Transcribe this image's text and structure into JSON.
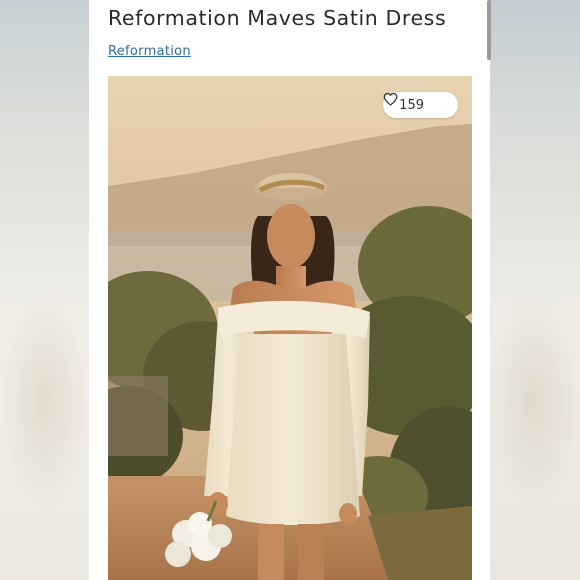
{
  "listing": {
    "title": "Reformation Maves Satin Dress",
    "brand_link": "Reformation",
    "like_count": "159",
    "like_icon": "heart-outline-icon"
  }
}
